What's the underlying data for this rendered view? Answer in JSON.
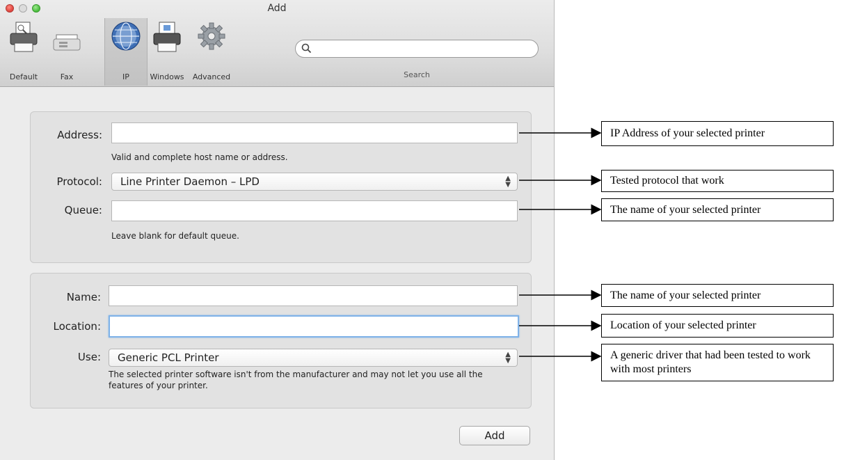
{
  "window": {
    "title": "Add",
    "toolbar": [
      {
        "label": "Default",
        "icon": "default-printer-icon"
      },
      {
        "label": "Fax",
        "icon": "fax-icon"
      },
      {
        "label": "IP",
        "icon": "globe-icon",
        "selected": true
      },
      {
        "label": "Windows",
        "icon": "windows-printer-icon"
      },
      {
        "label": "Advanced",
        "icon": "gear-icon"
      }
    ],
    "search": {
      "label": "Search",
      "value": "",
      "placeholder": ""
    }
  },
  "ip_section": {
    "address": {
      "label": "Address:",
      "value": "",
      "hint": "Valid and complete host name or address."
    },
    "protocol": {
      "label": "Protocol:",
      "value": "Line Printer Daemon – LPD"
    },
    "queue": {
      "label": "Queue:",
      "value": "",
      "hint": "Leave blank for default queue."
    }
  },
  "printer_section": {
    "name": {
      "label": "Name:",
      "value": ""
    },
    "location": {
      "label": "Location:",
      "value": ""
    },
    "use": {
      "label": "Use:",
      "value": "Generic PCL Printer",
      "hint": "The selected printer software isn't from the manufacturer and may not let you use all the features of your printer."
    }
  },
  "add_button": "Add",
  "annotations": [
    "IP Address of your selected printer",
    "Tested protocol that work",
    "The name of your selected printer",
    "The name of your selected printer",
    "Location of your selected printer",
    "A generic driver that had been tested to work with most printers"
  ],
  "colors": {
    "focus_ring": "#7fb2e8",
    "close": "#e0443e",
    "maximize": "#4cbf3f"
  }
}
